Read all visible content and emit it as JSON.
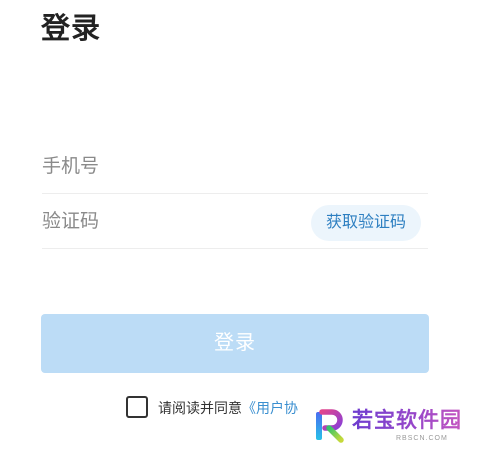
{
  "page": {
    "title": "登录"
  },
  "form": {
    "phone_placeholder": "手机号",
    "code_placeholder": "验证码",
    "get_code_label": "获取验证码",
    "submit_label": "登录"
  },
  "agreement": {
    "checked": false,
    "prefix": "请阅读并同意",
    "link": "《用户协"
  },
  "watermark": {
    "brand": "若宝软件园",
    "domain": "RBSCN.COM",
    "logo_icon": "r-logo-icon"
  },
  "colors": {
    "title": "#222222",
    "placeholder": "#8a8a8a",
    "divider": "#ededed",
    "accent": "#2d7fc1",
    "get_code_bg": "#ecf5fc",
    "submit_bg": "#bcdcf6",
    "link": "#3a8fd0"
  }
}
